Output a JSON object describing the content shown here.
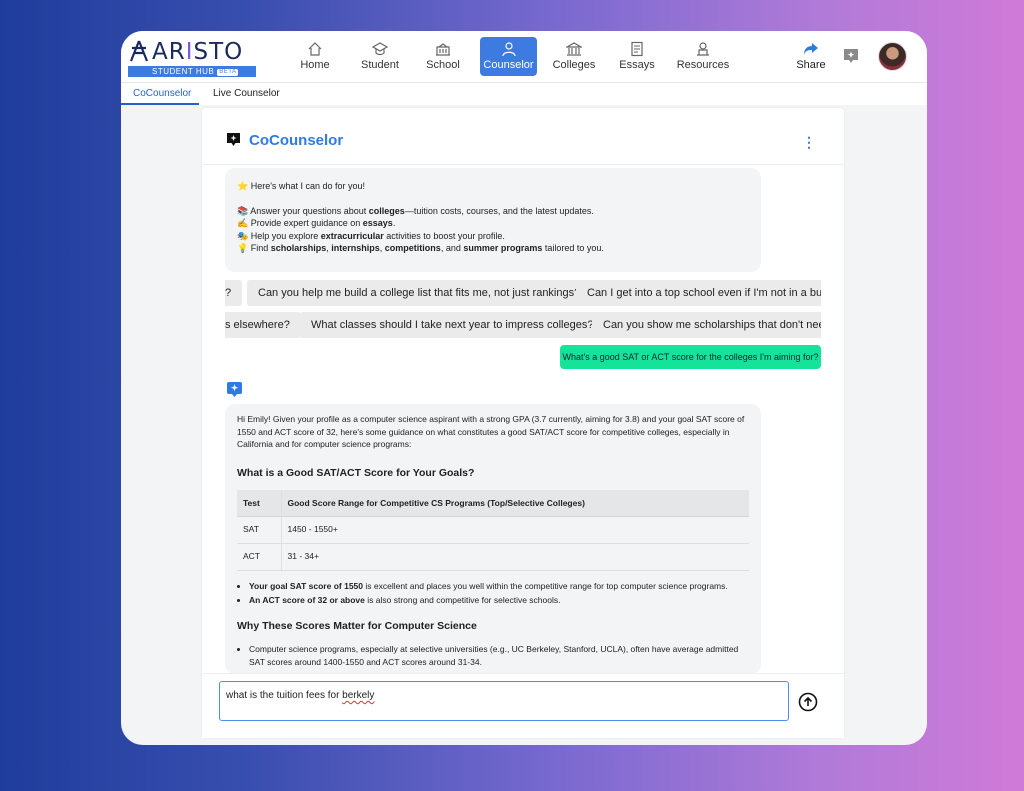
{
  "brand": {
    "name_a": "AR",
    "name_i": "I",
    "name_b": "STO",
    "hub": "STUDENT HUB",
    "beta": "BETA"
  },
  "nav": [
    {
      "label": "Home",
      "icon": "home-icon"
    },
    {
      "label": "Student",
      "icon": "graduation-cap-icon"
    },
    {
      "label": "School",
      "icon": "school-building-icon"
    },
    {
      "label": "Counselor",
      "icon": "person-icon"
    },
    {
      "label": "Colleges",
      "icon": "university-icon"
    },
    {
      "label": "Essays",
      "icon": "document-icon"
    },
    {
      "label": "Resources",
      "icon": "resources-icon"
    }
  ],
  "header": {
    "share": "Share"
  },
  "subtabs": [
    "CoCounselor",
    "Live Counselor"
  ],
  "panel": {
    "title": "CoCounselor"
  },
  "intro": {
    "line1": "⭐ Here's what I can do for you!",
    "b1_pre": "📚 Answer your questions about ",
    "b1_bold": "colleges",
    "b1_post": "—tuition costs, courses, and the latest updates.",
    "b2_pre": "✍️ Provide expert guidance on ",
    "b2_bold": "essays",
    "b2_post": ".",
    "b3_pre": "🎭 Help you explore ",
    "b3_bold": "extracurricular",
    "b3_post": " activities to boost your profile.",
    "b4_pre": "💡 Find ",
    "b4_bold1": "scholarships",
    "b4_sep1": ", ",
    "b4_bold2": "internships",
    "b4_sep2": ", ",
    "b4_bold3": "competitions",
    "b4_sep3": ", and ",
    "b4_bold4": "summer programs",
    "b4_post": " tailored to you."
  },
  "chips_row1": [
    "?",
    "Can you help me build a college list that fits me, not just rankings?",
    "Can I get into a top school even if I'm not in a bunch"
  ],
  "chips_row2": [
    "s elsewhere?",
    "What classes should I take next year to impress colleges?",
    "Can you show me scholarships that don't need p"
  ],
  "user_message": "What's a good SAT or ACT score for the colleges I'm aiming for?",
  "reply": {
    "intro": "Hi Emily! Given your profile as a computer science aspirant with a strong GPA (3.7 currently, aiming for 3.8) and your goal SAT score of 1550 and ACT score of 32, here's some guidance on what constitutes a good SAT/ACT score for competitive colleges, especially in California and for computer science programs:",
    "heading1": "What is a Good SAT/ACT Score for Your Goals?",
    "table_headers": [
      "Test",
      "Good Score Range for Competitive CS Programs (Top/Selective Colleges)"
    ],
    "table_rows": [
      [
        "SAT",
        "1450 - 1550+"
      ],
      [
        "ACT",
        "31 - 34+"
      ]
    ],
    "bullet1_bold": "Your goal SAT score of 1550",
    "bullet1_rest": " is excellent and places you well within the competitive range for top computer science programs.",
    "bullet2_bold": "An ACT score of 32 or above",
    "bullet2_rest": " is also strong and competitive for selective schools.",
    "heading2": "Why These Scores Matter for Computer Science",
    "bullet3": "Computer science programs, especially at selective universities (e.g., UC Berkeley, Stanford, UCLA), often have average admitted SAT scores around 1400-1550 and ACT scores around 31-34."
  },
  "input": {
    "text_pre": "what is the tuition fees for ",
    "text_misspelled": "berkely"
  },
  "colors": {
    "accent": "#3d7be0",
    "user_bubble": "#16e39a",
    "title": "#2f7be6"
  }
}
